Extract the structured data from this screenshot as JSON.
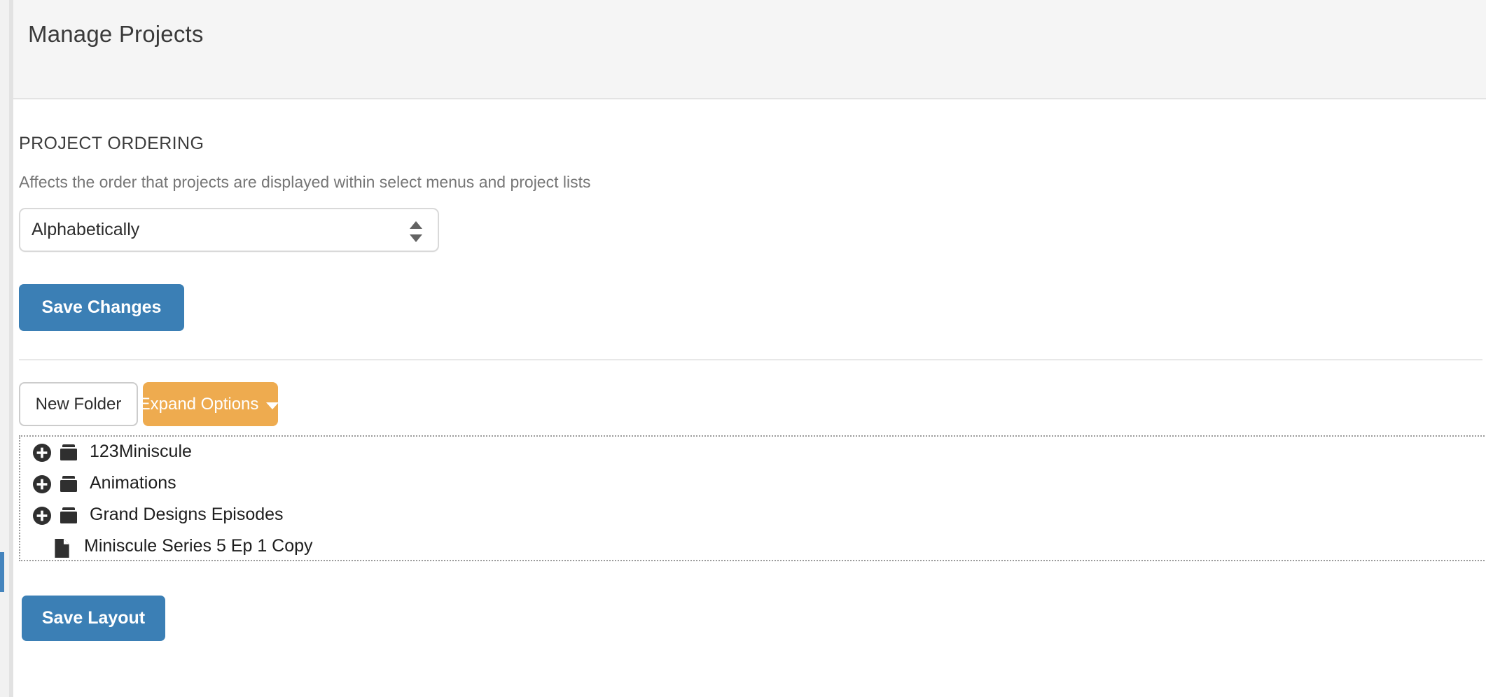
{
  "header": {
    "title": "Manage Projects"
  },
  "ordering": {
    "heading": "PROJECT ORDERING",
    "description": "Affects the order that projects are displayed within select menus and project lists",
    "select": {
      "value": "Alphabetically",
      "options": [
        "Alphabetically"
      ]
    },
    "save_label": "Save Changes"
  },
  "toolbar": {
    "new_folder_label": "New Folder",
    "expand_options_label": "Expand Options"
  },
  "tree": {
    "items": [
      {
        "label": "123Miniscule",
        "type": "folder",
        "toggle": "plus-circle-icon",
        "depth": 0
      },
      {
        "label": "Animations",
        "type": "folder",
        "toggle": "plus-circle-icon",
        "depth": 0
      },
      {
        "label": "Grand Designs Episodes",
        "type": "folder",
        "toggle": "plus-circle-icon",
        "depth": 0
      },
      {
        "label": "Miniscule Series 5 Ep 1 Copy",
        "type": "file",
        "toggle": null,
        "depth": 1
      }
    ]
  },
  "layout": {
    "save_label": "Save Layout"
  },
  "colors": {
    "primary_button": "#3b7fb5",
    "warning_button": "#eeab4f",
    "accent_bar": "#4484bd",
    "header_bg": "#f5f5f5"
  }
}
